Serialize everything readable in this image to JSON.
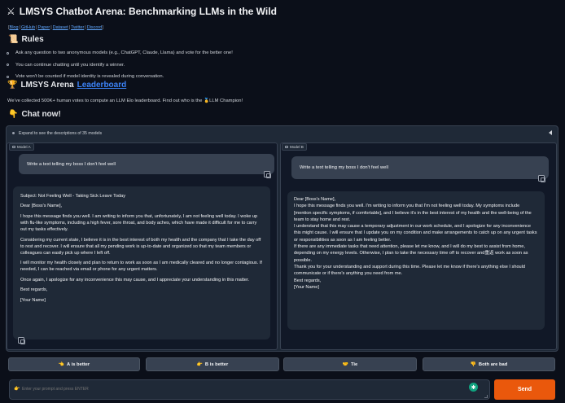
{
  "header": {
    "icon": "crossed-swords",
    "title": "LMSYS Chatbot Arena: Benchmarking LLMs in the Wild"
  },
  "links": [
    "Blog",
    "GitHub",
    "Paper",
    "Dataset",
    "Twitter",
    "Discord"
  ],
  "rules": {
    "icon": "scroll",
    "heading": "Rules",
    "items": [
      "Ask any question to two anonymous models (e.g., ChatGPT, Claude, Llama) and vote for the better one!",
      "You can continue chatting until you identify a winner.",
      "Vote won't be counted if model identity is revealed during conversation."
    ]
  },
  "arena": {
    "icon": "trophy",
    "heading_prefix": "LMSYS Arena",
    "heading_link": "Leaderboard",
    "description_before": "We've collected 500K+ human votes to compute an LLM Elo leaderboard. Find out who is the",
    "description_icon": "medal",
    "description_after": "LLM Champion!"
  },
  "chat_now": {
    "icon": "pointing-down",
    "heading": "Chat now!"
  },
  "accordion": {
    "label": "Expand to see the descriptions of 35 models"
  },
  "model_a": {
    "label": "Model A",
    "user_message": "Write a text telling my boss I don't feel well",
    "response": [
      "Subject: Not Feeling Well - Taking Sick Leave Today",
      "Dear [Boss's Name],",
      "I hope this message finds you well. I am writing to inform you that, unfortunately, I am not feeling well today. I woke up with flu-like symptoms, including a high fever, sore throat, and body aches, which have made it difficult for me to carry out my tasks effectively.",
      "Considering my current state, I believe it is in the best interest of both my health and the company that I take the day off to rest and recover. I will ensure that all my pending work is up-to-date and organized so that my team members or colleagues can easily pick up where I left off.",
      "I will monitor my health closely and plan to return to work as soon as I am medically cleared and no longer contagious. If needed, I can be reached via email or phone for any urgent matters.",
      "Once again, I apologize for any inconvenience this may cause, and I appreciate your understanding in this matter.",
      "Best regards,",
      "[Your Name]"
    ]
  },
  "model_b": {
    "label": "Model B",
    "user_message": "Write a text telling my boss I don't feel well",
    "response": [
      "Dear [Boss's Name],",
      "I hope this message finds you well. I'm writing to inform you that I'm not feeling well today. My symptoms include [mention specific symptoms, if comfortable], and I believe it's in the best interest of my health and the well-being of the team to stay home and rest.",
      "I understand that this may cause a temporary adjustment in our work schedule, and I apologize for any inconvenience this might cause. I will ensure that I update you on my condition and make arrangements to catch up on any urgent tasks or responsibilities as soon as I am feeling better.",
      "If there are any immediate tasks that need attention, please let me know, and I will do my best to assist from home, depending on my energy levels. Otherwise, I plan to take the necessary time off to recover and重返 work as soon as possible.",
      "Thank you for your understanding and support during this time. Please let me know if there's anything else I should communicate or if there's anything you need from me.",
      "Best regards,",
      "[Your Name]"
    ]
  },
  "votes": [
    {
      "icon": "pointing-left",
      "label": "A is better"
    },
    {
      "icon": "pointing-right",
      "label": "B is better"
    },
    {
      "icon": "handshake",
      "label": "Tie"
    },
    {
      "icon": "thumbs-down",
      "label": "Both are bad"
    }
  ],
  "input": {
    "icon": "pointing-right",
    "placeholder": "Enter your prompt and press ENTER",
    "send_label": "Send"
  }
}
